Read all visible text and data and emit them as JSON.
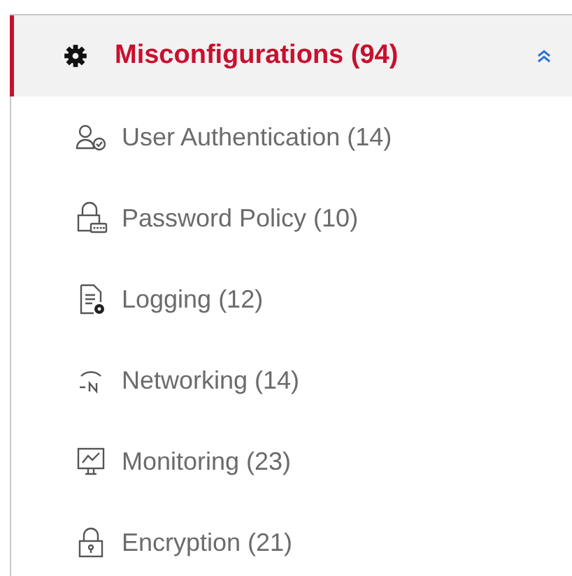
{
  "section": {
    "title": "Misconfigurations (94)",
    "expanded": true,
    "items": [
      {
        "kind": "user",
        "label": "User Authentication (14)"
      },
      {
        "kind": "password",
        "label": "Password Policy (10)"
      },
      {
        "kind": "log",
        "label": "Logging (12)"
      },
      {
        "kind": "network",
        "label": "Networking (14)"
      },
      {
        "kind": "monitor",
        "label": "Monitoring (23)"
      },
      {
        "kind": "lock",
        "label": "Encryption (21)"
      }
    ]
  }
}
